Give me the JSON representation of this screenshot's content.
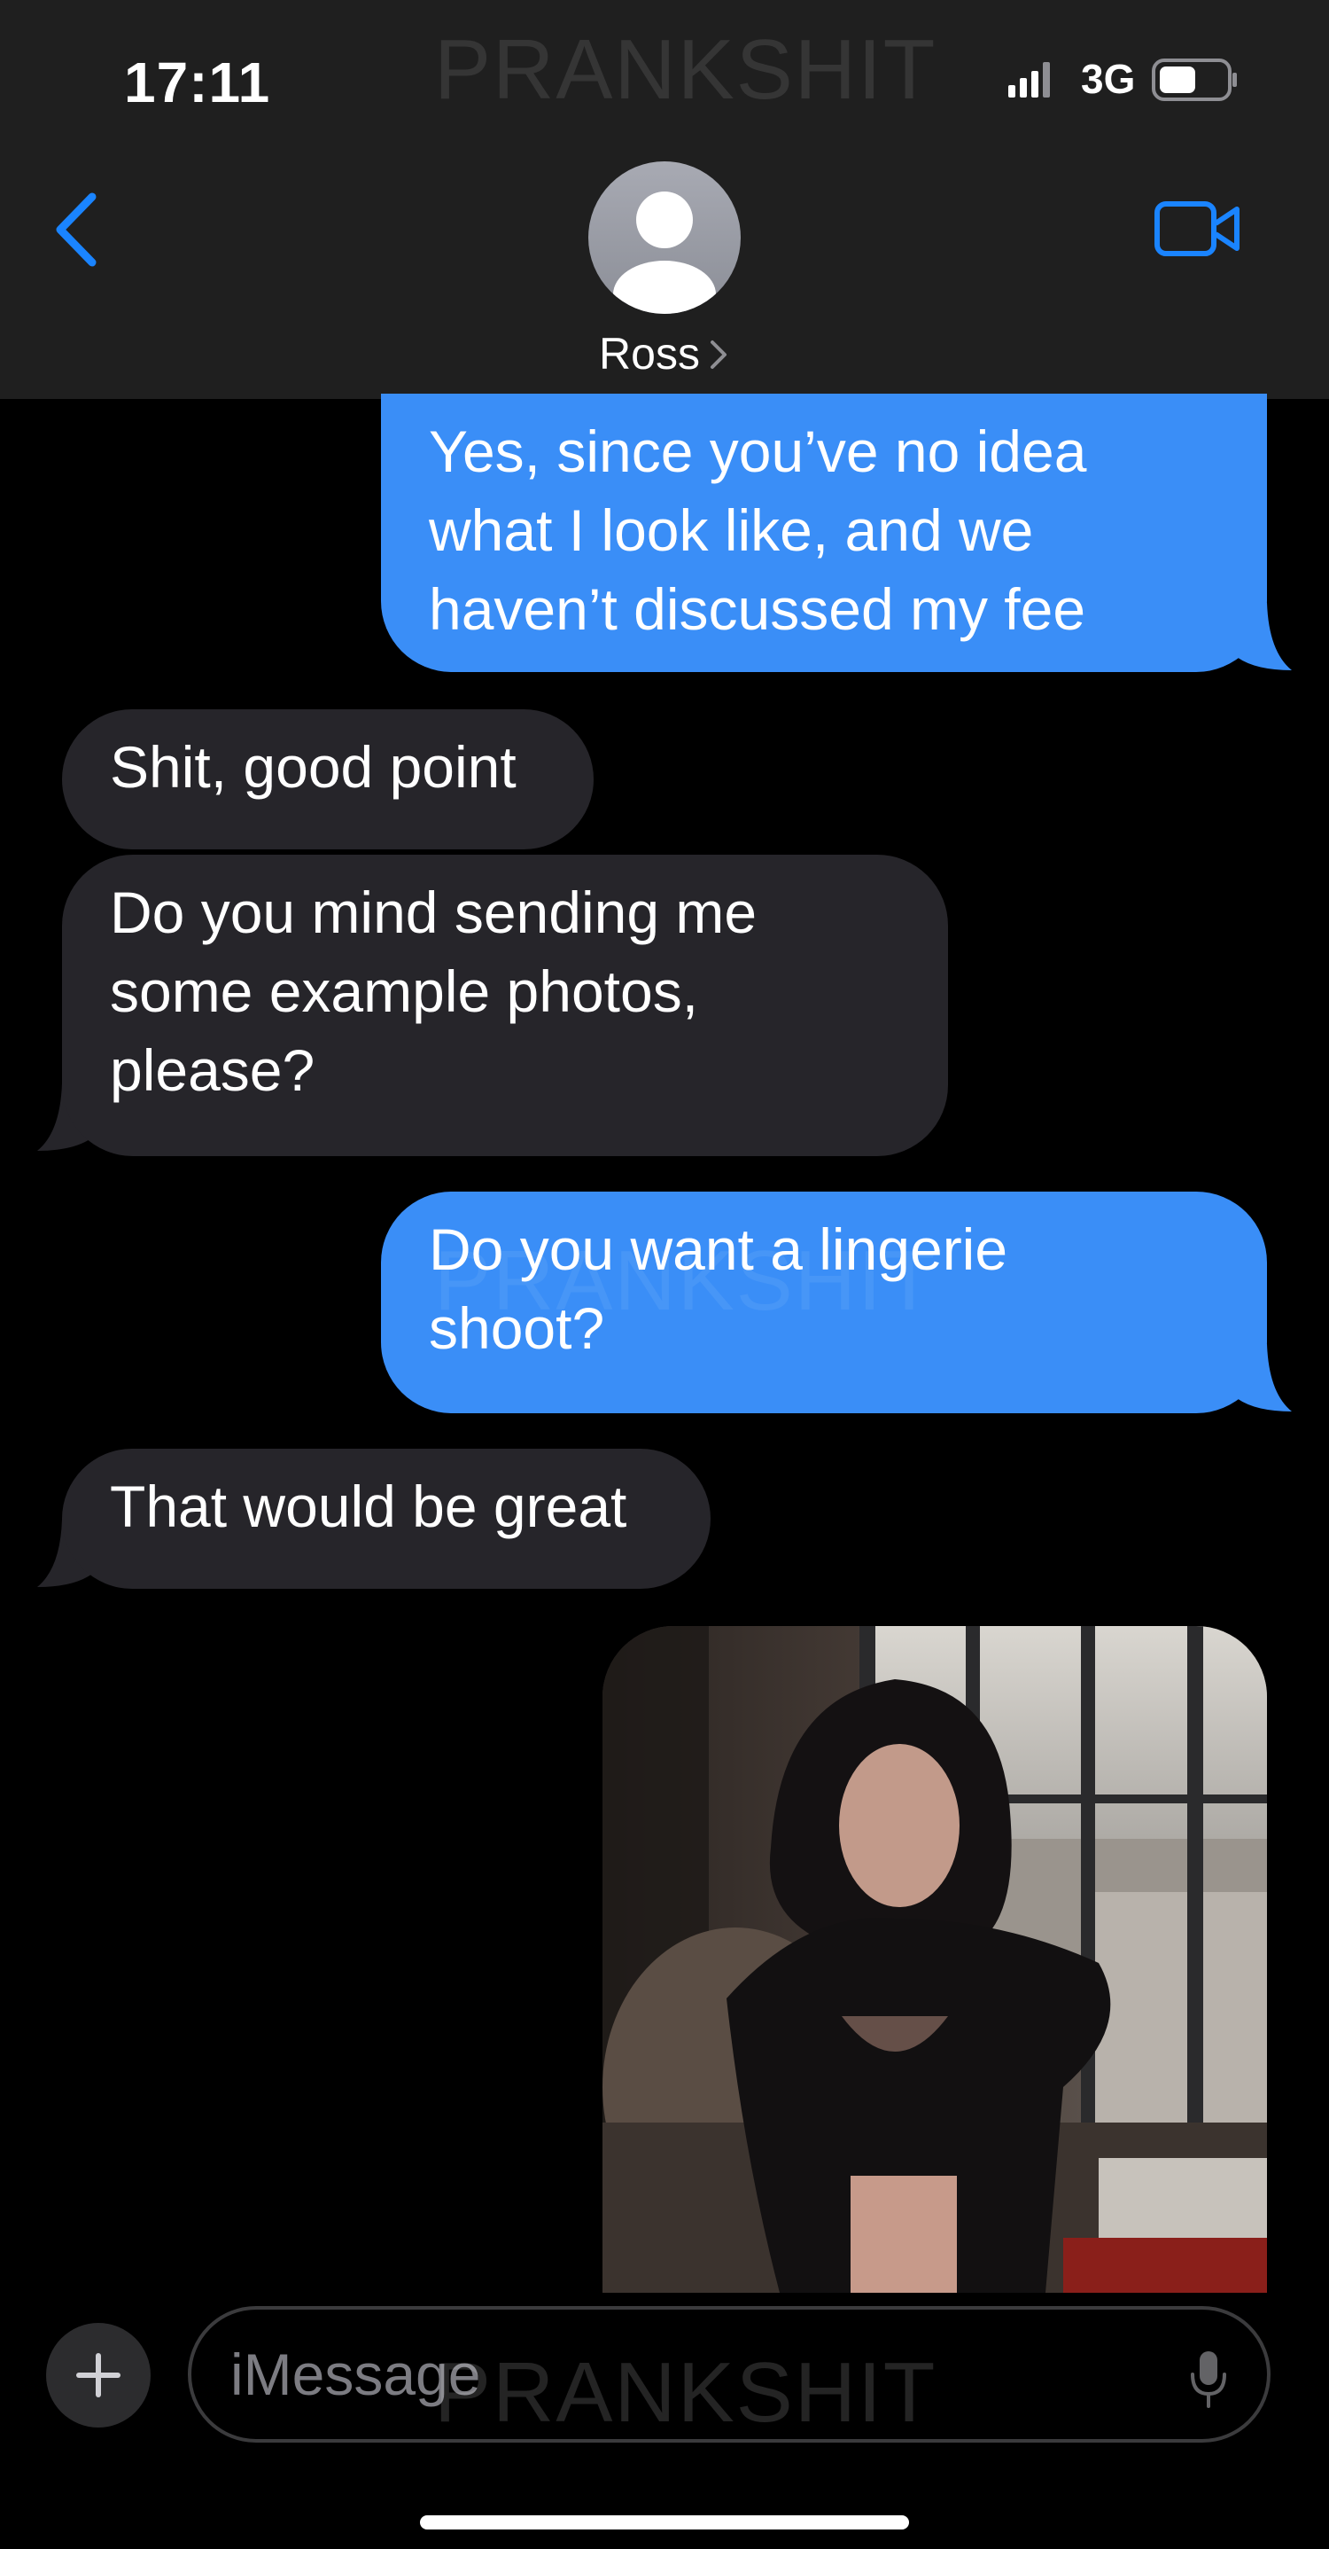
{
  "status_bar": {
    "time": "17:11",
    "network": "3G",
    "signal_icon": "cellular-signal-icon",
    "battery_icon": "battery-icon",
    "battery_level": 0.55
  },
  "watermark": "PRANKSHIT",
  "header": {
    "back_icon": "chevron-left-icon",
    "video_icon": "video-camera-icon",
    "avatar_icon": "person-silhouette-icon",
    "contact_name": "Ross",
    "contact_chevron": "chevron-right-icon"
  },
  "messages": [
    {
      "direction": "outgoing",
      "lines": [
        "Yes, since you’ve no idea",
        "what I look like, and we",
        "haven’t discussed my fee"
      ]
    },
    {
      "direction": "incoming",
      "lines": [
        "Shit, good point"
      ]
    },
    {
      "direction": "incoming",
      "lines": [
        "Do you mind sending me",
        "some example photos,",
        "please?"
      ]
    },
    {
      "direction": "outgoing",
      "lines": [
        "Do you want a lingerie",
        "shoot?"
      ]
    },
    {
      "direction": "incoming",
      "lines": [
        "That would be great"
      ]
    },
    {
      "direction": "outgoing",
      "type": "photo",
      "description_icon": "photo-attachment-icon"
    }
  ],
  "composer": {
    "placeholder": "iMessage",
    "plus_icon": "plus-icon",
    "mic_icon": "microphone-icon"
  },
  "colors": {
    "outgoing_bubble": "#3a8ef7",
    "incoming_bubble": "#26252a",
    "header_bg": "#1f1f1f",
    "accent_blue": "#1a84ff",
    "background": "#000000"
  }
}
